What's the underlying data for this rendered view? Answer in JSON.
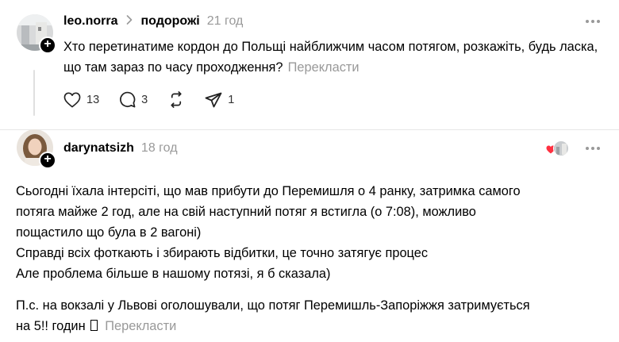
{
  "post": {
    "username": "leo.norra",
    "topic": "подорожі",
    "time": "21 год",
    "text": "Хто перетинатиме кордон до Польщі найближчим часом потягом, розкажіть, будь ласка, що там зараз по часу проходження?",
    "translate_label": "Перекласти",
    "actions": {
      "like_count": "13",
      "comment_count": "3",
      "share_count": "1"
    }
  },
  "reply": {
    "username": "darynatsizh",
    "time": "18 год",
    "line1": "Сьогодні їхала інтерсіті, що мав прибути до Перемишля о 4 ранку, затримка самого",
    "line2": "потяга майже 2 год, але на свій наступний потяг я встигла (о 7:08), можливо",
    "line3": "пощастило що була в 2 вагоні)",
    "line4": "Справді всіх фоткають і збирають відбитки, це точно затягує процес",
    "line5": "Але проблема більше в нашому потязі, я б сказала)",
    "line6": "П.с. на вокзалі у Львові оголошували, що потяг Перемишль-Запоріжжя затримується",
    "line7": "на 5!! годин",
    "translate_label": "Перекласти"
  },
  "icons": {
    "like": "heart-icon",
    "comment": "comment-icon",
    "repost": "repost-icon",
    "share": "send-icon",
    "more": "more-dots-icon",
    "follow": "plus-icon",
    "reaction": "heart-reaction-icon"
  },
  "colors": {
    "text": "#000000",
    "muted": "#999999",
    "reaction_heart": "#ff3040"
  }
}
